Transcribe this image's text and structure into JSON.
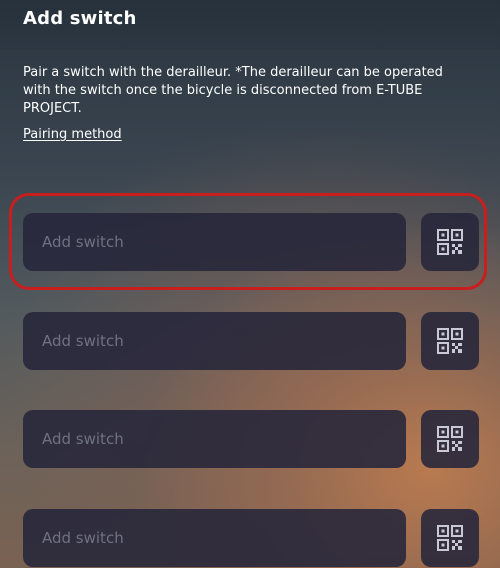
{
  "header": {
    "title": "Add switch"
  },
  "description": "Pair a switch with the derailleur. *The derailleur can be operated with the switch once the bicycle is disconnected from E-TUBE PROJECT.",
  "pairing_link": "Pairing method",
  "switch_rows": [
    {
      "placeholder": "Add switch",
      "qr_icon": "qr-code-icon"
    },
    {
      "placeholder": "Add switch",
      "qr_icon": "qr-code-icon"
    },
    {
      "placeholder": "Add switch",
      "qr_icon": "qr-code-icon"
    },
    {
      "placeholder": "Add switch",
      "qr_icon": "qr-code-icon"
    }
  ],
  "colors": {
    "highlight": "#c81e1e",
    "field_background": "#26263a",
    "placeholder_text": "#6f7183"
  }
}
